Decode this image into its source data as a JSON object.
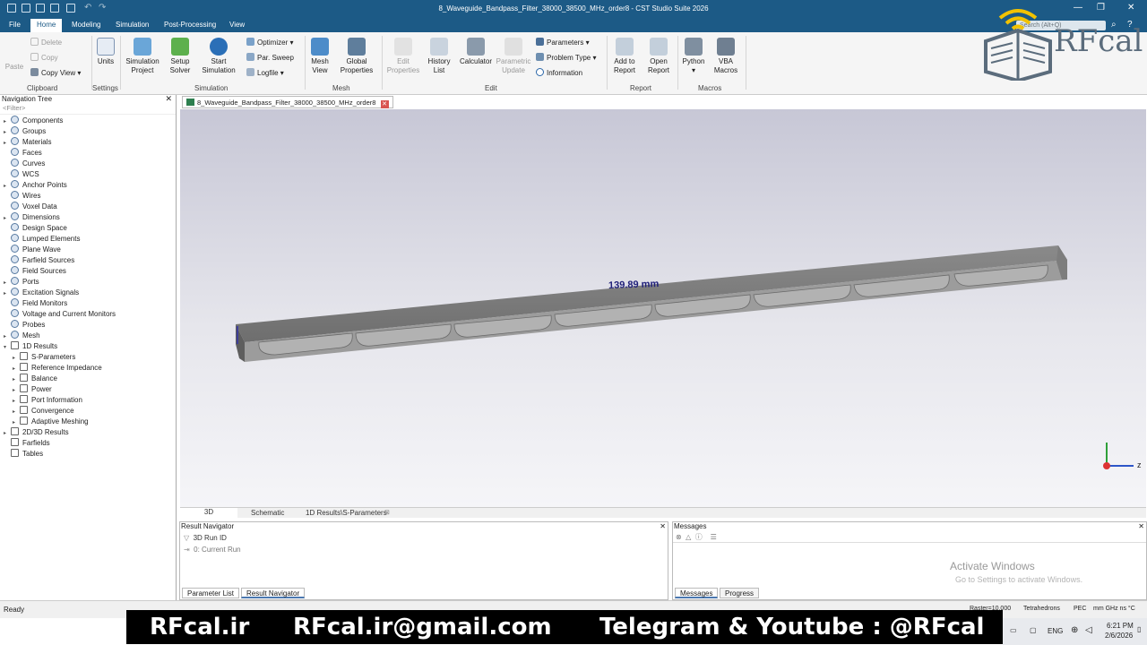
{
  "window": {
    "title": "8_Waveguide_Bandpass_Filter_38000_38500_MHz_order8 - CST Studio Suite 2026",
    "search_placeholder": "Search (Alt+Q)"
  },
  "menu": [
    "File",
    "Home",
    "Modeling",
    "Simulation",
    "Post-Processing",
    "View"
  ],
  "ribbon": {
    "clipboard": {
      "paste": "Paste",
      "delete": "Delete",
      "copy": "Copy",
      "copy_view": "Copy View",
      "group": "Clipboard"
    },
    "settings": {
      "units": "Units",
      "group": "Settings"
    },
    "simulation": {
      "sim_project": "Simulation\nProject",
      "setup_solver": "Setup\nSolver",
      "start_sim": "Start\nSimulation",
      "optimizer": "Optimizer",
      "par_sweep": "Par. Sweep",
      "logfile": "Logfile",
      "group": "Simulation"
    },
    "mesh": {
      "mesh_view": "Mesh\nView",
      "global_props": "Global\nProperties",
      "group": "Mesh"
    },
    "edit": {
      "edit_props": "Edit\nProperties",
      "history": "History\nList",
      "calculator": "Calculator",
      "param_update": "Parametric\nUpdate",
      "parameters": "Parameters",
      "problem_type": "Problem Type",
      "information": "Information",
      "group": "Edit"
    },
    "report": {
      "add": "Add to\nReport",
      "open": "Open\nReport",
      "group": "Report"
    },
    "macros": {
      "python": "Python",
      "vba": "VBA\nMacros",
      "group": "Macros"
    }
  },
  "nav": {
    "title": "Navigation Tree",
    "filter": "<Filter>",
    "items": [
      {
        "label": "Components",
        "level": 0,
        "exp": "▸",
        "icon": "round"
      },
      {
        "label": "Groups",
        "level": 0,
        "exp": "▸",
        "icon": "round"
      },
      {
        "label": "Materials",
        "level": 0,
        "exp": "▸",
        "icon": "round"
      },
      {
        "label": "Faces",
        "level": 0,
        "exp": "",
        "icon": "round"
      },
      {
        "label": "Curves",
        "level": 0,
        "exp": "",
        "icon": "round"
      },
      {
        "label": "WCS",
        "level": 0,
        "exp": "",
        "icon": "round"
      },
      {
        "label": "Anchor Points",
        "level": 0,
        "exp": "▸",
        "icon": "round"
      },
      {
        "label": "Wires",
        "level": 0,
        "exp": "",
        "icon": "round"
      },
      {
        "label": "Voxel Data",
        "level": 0,
        "exp": "",
        "icon": "round"
      },
      {
        "label": "Dimensions",
        "level": 0,
        "exp": "▸",
        "icon": "round"
      },
      {
        "label": "Design Space",
        "level": 0,
        "exp": "",
        "icon": "round"
      },
      {
        "label": "Lumped Elements",
        "level": 0,
        "exp": "",
        "icon": "round"
      },
      {
        "label": "Plane Wave",
        "level": 0,
        "exp": "",
        "icon": "round"
      },
      {
        "label": "Farfield Sources",
        "level": 0,
        "exp": "",
        "icon": "round"
      },
      {
        "label": "Field Sources",
        "level": 0,
        "exp": "",
        "icon": "round"
      },
      {
        "label": "Ports",
        "level": 0,
        "exp": "▸",
        "icon": "round"
      },
      {
        "label": "Excitation Signals",
        "level": 0,
        "exp": "▸",
        "icon": "round"
      },
      {
        "label": "Field Monitors",
        "level": 0,
        "exp": "",
        "icon": "round"
      },
      {
        "label": "Voltage and Current Monitors",
        "level": 0,
        "exp": "",
        "icon": "round"
      },
      {
        "label": "Probes",
        "level": 0,
        "exp": "",
        "icon": "round"
      },
      {
        "label": "Mesh",
        "level": 0,
        "exp": "▸",
        "icon": "round"
      },
      {
        "label": "1D Results",
        "level": 0,
        "exp": "▾",
        "icon": "fold"
      },
      {
        "label": "S-Parameters",
        "level": 1,
        "exp": "▸",
        "icon": "fold"
      },
      {
        "label": "Reference Impedance",
        "level": 1,
        "exp": "▸",
        "icon": "fold"
      },
      {
        "label": "Balance",
        "level": 1,
        "exp": "▸",
        "icon": "fold"
      },
      {
        "label": "Power",
        "level": 1,
        "exp": "▸",
        "icon": "fold"
      },
      {
        "label": "Port Information",
        "level": 1,
        "exp": "▸",
        "icon": "fold"
      },
      {
        "label": "Convergence",
        "level": 1,
        "exp": "▸",
        "icon": "fold"
      },
      {
        "label": "Adaptive Meshing",
        "level": 1,
        "exp": "▸",
        "icon": "fold"
      },
      {
        "label": "2D/3D Results",
        "level": 0,
        "exp": "▸",
        "icon": "fold"
      },
      {
        "label": "Farfields",
        "level": 0,
        "exp": "",
        "icon": "fold"
      },
      {
        "label": "Tables",
        "level": 0,
        "exp": "",
        "icon": "fold"
      }
    ]
  },
  "doc_tab": "8_Waveguide_Bandpass_Filter_38000_38500_MHz_order8",
  "viewport": {
    "dimension": "139.89 mm",
    "axis_z": "z"
  },
  "view_tabs": [
    "3D",
    "Schematic",
    "1D Results\\S-Parameters"
  ],
  "result_nav": {
    "title": "Result Navigator",
    "col": "3D Run ID",
    "row": "0: Current Run",
    "tabs": [
      "Parameter List",
      "Result Navigator"
    ]
  },
  "messages": {
    "title": "Messages",
    "tabs": [
      "Messages",
      "Progress"
    ]
  },
  "status": {
    "ready": "Ready",
    "raster": "Raster=10.000",
    "mesh": "Tetrahedrons",
    "pec": "PEC",
    "units": "mm  GHz  ns  °C"
  },
  "watermark": {
    "line1": "Activate Windows",
    "line2": "Go to Settings to activate Windows."
  },
  "banner": {
    "site": "RFcal.ir",
    "email": "RFcal.ir@gmail.com",
    "social": "Telegram & Youtube : @RFcal"
  },
  "taskbar": {
    "lang": "ENG",
    "time": "6:21 PM",
    "date": "2/6/2026"
  },
  "logo": {
    "text": "RFcal"
  }
}
